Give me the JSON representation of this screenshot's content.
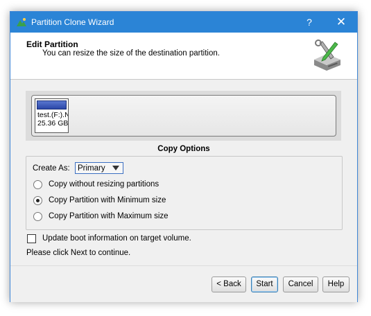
{
  "window": {
    "title": "Partition Clone Wizard",
    "help_glyph": "?",
    "close_glyph": "✕"
  },
  "header": {
    "title": "Edit Partition",
    "subtitle": "You can resize the size of the destination partition."
  },
  "disk": {
    "partition_name": "test.(F:).N",
    "partition_size": "25.36 GB"
  },
  "options": {
    "section_title": "Copy Options",
    "create_as_label": "Create As:",
    "create_as_value": "Primary",
    "radios": [
      {
        "label": "Copy without resizing partitions",
        "checked": false
      },
      {
        "label": "Copy Partition with Minimum size",
        "checked": true
      },
      {
        "label": "Copy Partition with Maximum size",
        "checked": false
      }
    ],
    "boot_checkbox_label": "Update boot information on target volume.",
    "boot_checkbox_checked": false
  },
  "hint": "Please click Next to continue.",
  "buttons": {
    "back": "< Back",
    "start": "Start",
    "cancel": "Cancel",
    "help": "Help"
  },
  "colors": {
    "titlebar": "#2b84d6",
    "partition_bar": "#2b47a8"
  }
}
